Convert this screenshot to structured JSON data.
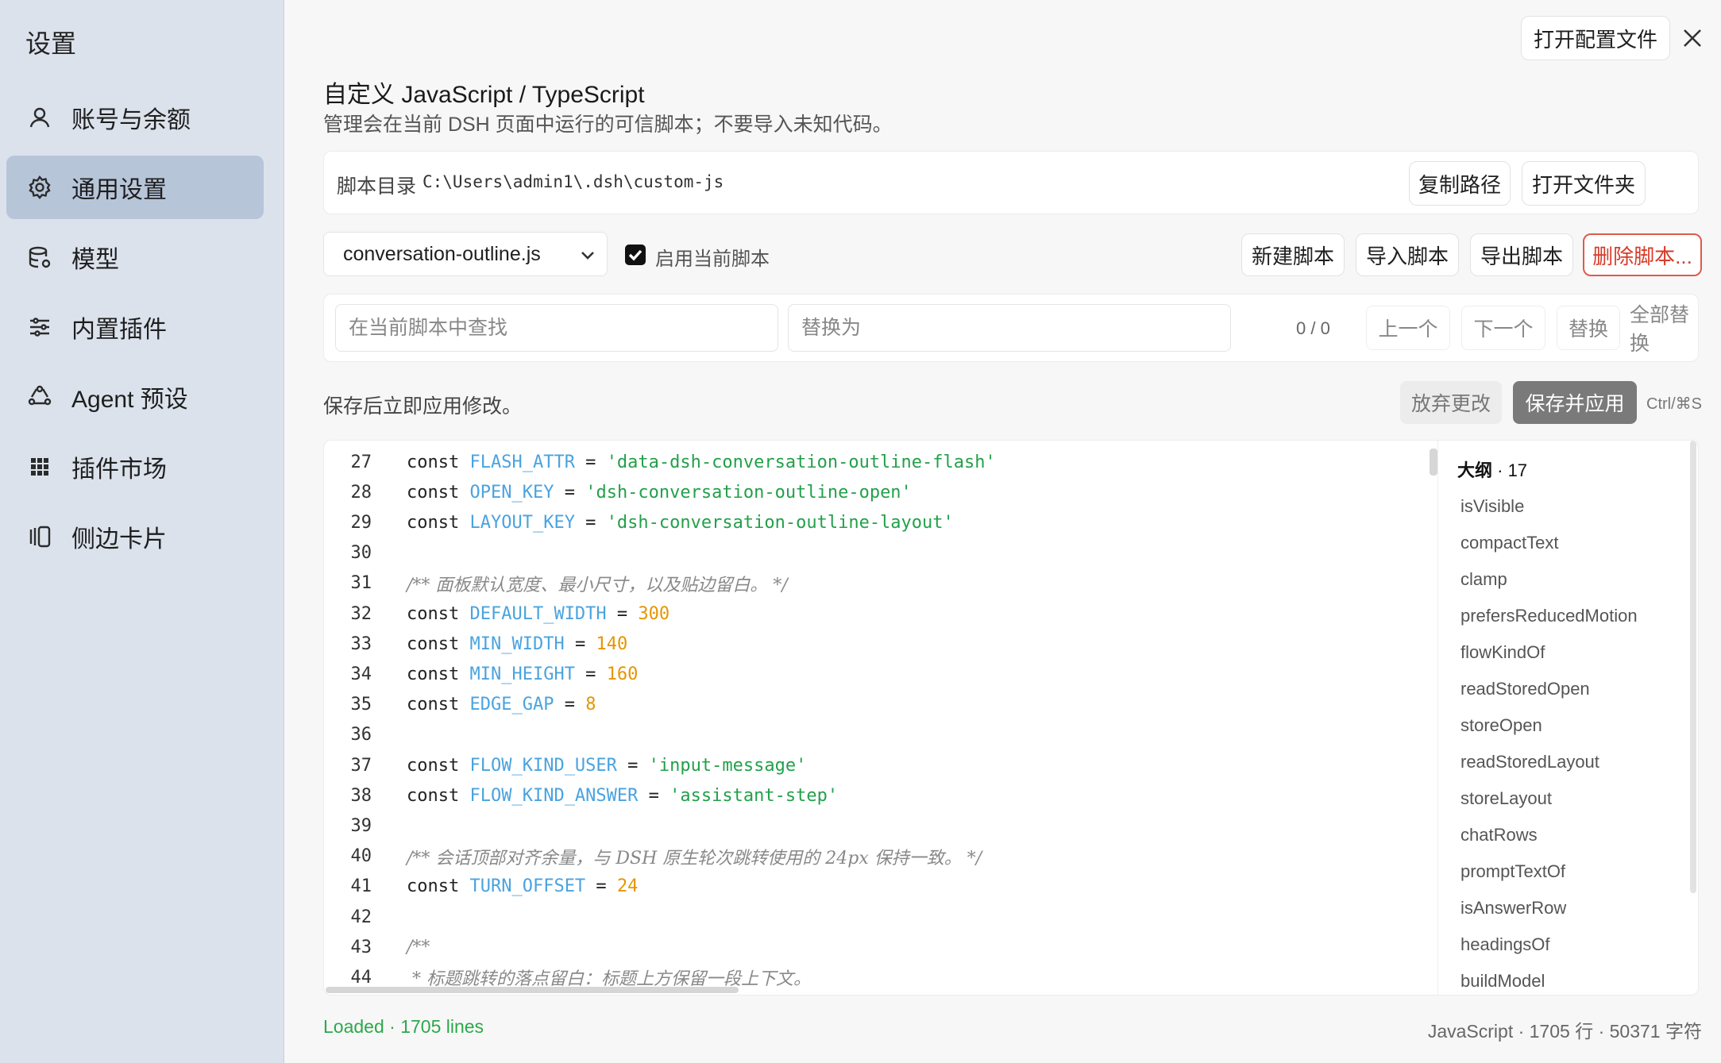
{
  "sidebar": {
    "title": "设置",
    "items": [
      {
        "label": "账号与余额",
        "icon": "user-icon"
      },
      {
        "label": "通用设置",
        "icon": "gear-icon"
      },
      {
        "label": "模型",
        "icon": "database-icon"
      },
      {
        "label": "内置插件",
        "icon": "sliders-icon"
      },
      {
        "label": "Agent 预设",
        "icon": "recycle-icon"
      },
      {
        "label": "插件市场",
        "icon": "grid-icon"
      },
      {
        "label": "侧边卡片",
        "icon": "cards-icon"
      }
    ]
  },
  "header": {
    "open_config": "打开配置文件",
    "title": "自定义 JavaScript / TypeScript",
    "description": "管理会在当前 DSH 页面中运行的可信脚本；不要导入未知代码。"
  },
  "directory": {
    "label": "脚本目录",
    "path": "C:\\Users\\admin1\\.dsh\\custom-js",
    "copy_path": "复制路径",
    "open_folder": "打开文件夹"
  },
  "script": {
    "selected": "conversation-outline.js",
    "enabled_label": "启用当前脚本",
    "enabled": true,
    "new": "新建脚本",
    "import": "导入脚本",
    "export": "导出脚本",
    "delete": "删除脚本..."
  },
  "find": {
    "find_placeholder": "在当前脚本中查找",
    "replace_placeholder": "替换为",
    "counter": "0 / 0",
    "prev": "上一个",
    "next": "下一个",
    "replace": "替换",
    "replace_all": "全部替换"
  },
  "save": {
    "hint": "保存后立即应用修改。",
    "discard": "放弃更改",
    "apply": "保存并应用",
    "shortcut": "Ctrl/⌘S"
  },
  "code": {
    "lines": [
      {
        "n": "27",
        "t": [
          [
            "kw",
            "const "
          ],
          [
            "cst",
            "FLASH_ATTR"
          ],
          [
            "kw",
            " = "
          ],
          [
            "str",
            "'data-dsh-conversation-outline-flash'"
          ]
        ]
      },
      {
        "n": "28",
        "t": [
          [
            "kw",
            "const "
          ],
          [
            "cst",
            "OPEN_KEY"
          ],
          [
            "kw",
            " = "
          ],
          [
            "str",
            "'dsh-conversation-outline-open'"
          ]
        ]
      },
      {
        "n": "29",
        "t": [
          [
            "kw",
            "const "
          ],
          [
            "cst",
            "LAYOUT_KEY"
          ],
          [
            "kw",
            " = "
          ],
          [
            "str",
            "'dsh-conversation-outline-layout'"
          ]
        ]
      },
      {
        "n": "30",
        "t": []
      },
      {
        "n": "31",
        "t": [
          [
            "cmt",
            "/** 面板默认宽度、最小尺寸，以及贴边留白。 */"
          ]
        ]
      },
      {
        "n": "32",
        "t": [
          [
            "kw",
            "const "
          ],
          [
            "cst",
            "DEFAULT_WIDTH"
          ],
          [
            "kw",
            " = "
          ],
          [
            "num",
            "300"
          ]
        ]
      },
      {
        "n": "33",
        "t": [
          [
            "kw",
            "const "
          ],
          [
            "cst",
            "MIN_WIDTH"
          ],
          [
            "kw",
            " = "
          ],
          [
            "num",
            "140"
          ]
        ]
      },
      {
        "n": "34",
        "t": [
          [
            "kw",
            "const "
          ],
          [
            "cst",
            "MIN_HEIGHT"
          ],
          [
            "kw",
            " = "
          ],
          [
            "num",
            "160"
          ]
        ]
      },
      {
        "n": "35",
        "t": [
          [
            "kw",
            "const "
          ],
          [
            "cst",
            "EDGE_GAP"
          ],
          [
            "kw",
            " = "
          ],
          [
            "num",
            "8"
          ]
        ]
      },
      {
        "n": "36",
        "t": []
      },
      {
        "n": "37",
        "t": [
          [
            "kw",
            "const "
          ],
          [
            "cst",
            "FLOW_KIND_USER"
          ],
          [
            "kw",
            " = "
          ],
          [
            "str",
            "'input-message'"
          ]
        ]
      },
      {
        "n": "38",
        "t": [
          [
            "kw",
            "const "
          ],
          [
            "cst",
            "FLOW_KIND_ANSWER"
          ],
          [
            "kw",
            " = "
          ],
          [
            "str",
            "'assistant-step'"
          ]
        ]
      },
      {
        "n": "39",
        "t": []
      },
      {
        "n": "40",
        "t": [
          [
            "cmt",
            "/** 会话顶部对齐余量，与 DSH 原生轮次跳转使用的 24px 保持一致。 */"
          ]
        ]
      },
      {
        "n": "41",
        "t": [
          [
            "kw",
            "const "
          ],
          [
            "cst",
            "TURN_OFFSET"
          ],
          [
            "kw",
            " = "
          ],
          [
            "num",
            "24"
          ]
        ]
      },
      {
        "n": "42",
        "t": []
      },
      {
        "n": "43",
        "t": [
          [
            "cmt",
            "/**"
          ]
        ]
      },
      {
        "n": "44",
        "t": [
          [
            "cmt",
            " * 标题跳转的落点留白：标题上方保留一段上下文。"
          ]
        ]
      }
    ]
  },
  "outline": {
    "title": "大纲",
    "count": " · 17",
    "items": [
      "isVisible",
      "compactText",
      "clamp",
      "prefersReducedMotion",
      "flowKindOf",
      "readStoredOpen",
      "storeOpen",
      "readStoredLayout",
      "storeLayout",
      "chatRows",
      "promptTextOf",
      "isAnswerRow",
      "headingsOf",
      "buildModel"
    ]
  },
  "status": {
    "left": "Loaded · 1705 lines",
    "right": "JavaScript · 1705 行 · 50371 字符"
  }
}
